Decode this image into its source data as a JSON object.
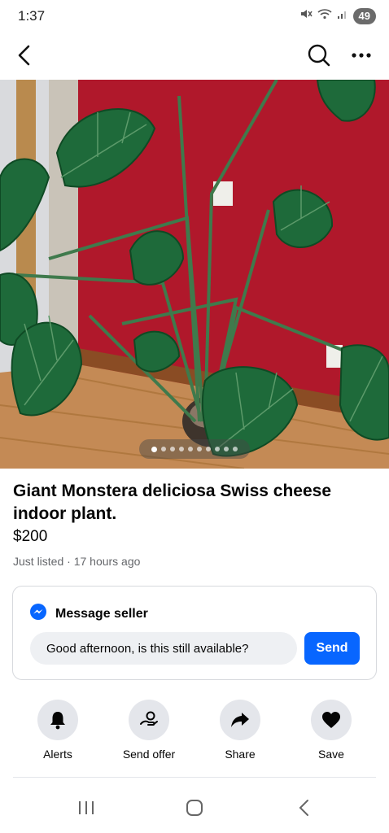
{
  "status_bar": {
    "time": "1:37",
    "battery": "49",
    "icons": [
      "mute-icon",
      "wifi-icon",
      "signal-icon",
      "battery-icon"
    ]
  },
  "top_nav": {
    "icons": [
      "back-arrow-icon",
      "search-icon",
      "more-options-icon"
    ]
  },
  "photo": {
    "dot_count": 10,
    "active_dot": 0
  },
  "listing": {
    "title": "Giant Monstera deliciosa Swiss cheese indoor plant.",
    "price": "$200",
    "meta": "Just listed · 17 hours ago"
  },
  "message": {
    "header": "Message seller",
    "icon": "messenger-icon",
    "input_value": "Good afternoon, is this still available?",
    "send_label": "Send"
  },
  "actions": [
    {
      "label": "Alerts",
      "icon": "bell-icon"
    },
    {
      "label": "Send offer",
      "icon": "offer-icon"
    },
    {
      "label": "Share",
      "icon": "share-arrow-icon"
    },
    {
      "label": "Save",
      "icon": "heart-icon"
    }
  ],
  "system_nav": {
    "icons": [
      "recent-apps-icon",
      "home-icon",
      "back-icon"
    ]
  },
  "colors": {
    "accent": "#0866ff",
    "wall": "#b0182b",
    "leaf": "#1e6a3a",
    "floor": "#c48a55"
  }
}
